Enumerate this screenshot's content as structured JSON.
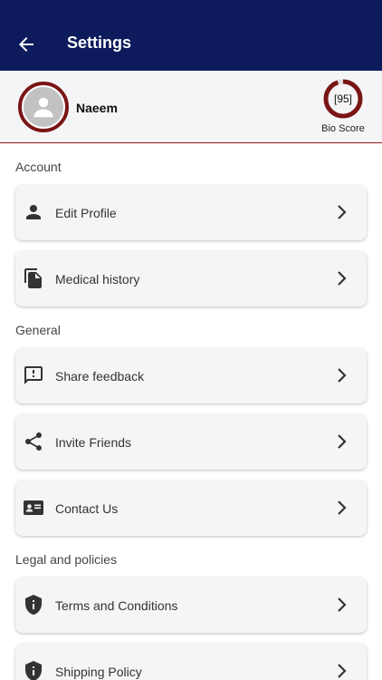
{
  "header": {
    "title": "Settings",
    "back_icon": "arrow-back-icon"
  },
  "profile": {
    "name": "Naeem",
    "avatar_icon": "person-avatar-icon"
  },
  "bio_score": {
    "value": "[95]",
    "percent": 95,
    "label": "Bio Score",
    "ring_color": "#7a1515"
  },
  "sections": {
    "account": {
      "label": "Account",
      "items": [
        {
          "label": "Edit Profile",
          "icon": "person-icon"
        },
        {
          "label": "Medical history",
          "icon": "file-copy-icon"
        }
      ]
    },
    "general": {
      "label": "General",
      "items": [
        {
          "label": "Share feedback",
          "icon": "feedback-icon"
        },
        {
          "label": "Invite Friends",
          "icon": "share-icon"
        },
        {
          "label": "Contact Us",
          "icon": "contact-card-icon"
        }
      ]
    },
    "legal": {
      "label": "Legal and policies",
      "items": [
        {
          "label": "Terms and Conditions",
          "icon": "shield-icon"
        },
        {
          "label": "Shipping Policy",
          "icon": "shield-icon"
        }
      ]
    }
  },
  "colors": {
    "appbar": "#0d1a5c",
    "accent": "#7a1515"
  }
}
